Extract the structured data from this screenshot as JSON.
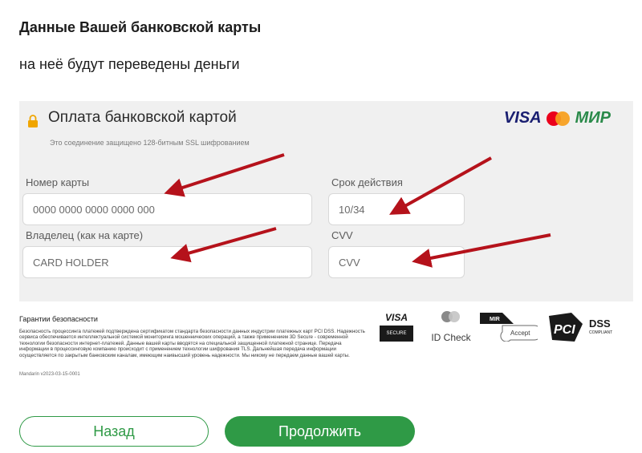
{
  "header": {
    "title": "Данные Вашей банковской карты",
    "subtitle": "на неё будут переведены деньги"
  },
  "payment": {
    "title": "Оплата банковской картой",
    "note": "Это соединение защищено 128-битным SSL шифрованием",
    "logos": {
      "visa": "VISA",
      "mir": "МИР"
    },
    "card_number": {
      "label": "Номер карты",
      "placeholder": "0000 0000 0000 0000 000"
    },
    "expiry": {
      "label": "Срок действия",
      "placeholder": "10/34"
    },
    "holder": {
      "label": "Владелец (как на карте)",
      "placeholder": "CARD HOLDER"
    },
    "cvv": {
      "label": "CVV",
      "placeholder": "CVV"
    }
  },
  "security": {
    "title": "Гарантии безопасности",
    "text": "Безопасность процессинга платежей подтверждена сертификатом стандарта безопасности данных индустрии платежных карт PCI DSS. Надежность сервиса обеспечивается интеллектуальной системой мониторинга мошеннических операций, а также применением 3D Secure - современной технологии безопасности интернет-платежей. Данные вашей карты вводятся на специальной защищенной платежной странице. Передача информации в процессинговую компанию происходит с применением технологии шифрования TLS. Дальнейшая передача информации осуществляется по закрытым банковским каналам, имеющим наивысший уровень надежности. Мы никому не передаем данные вашей карты.",
    "version": "Mandarin v2023-03-15-0001",
    "badges": {
      "visa_top": "VISA",
      "visa_bottom": "SECURE",
      "idcheck": "ID Check",
      "mir": "MIR",
      "accept": "Accept",
      "pci": "PCI",
      "dss": "DSS",
      "compliant": "COMPLIANT"
    }
  },
  "actions": {
    "back": "Назад",
    "next": "Продолжить"
  },
  "colors": {
    "accent": "#2f9a46",
    "arrow": "#b5121b",
    "panel": "#f0f0f0"
  }
}
